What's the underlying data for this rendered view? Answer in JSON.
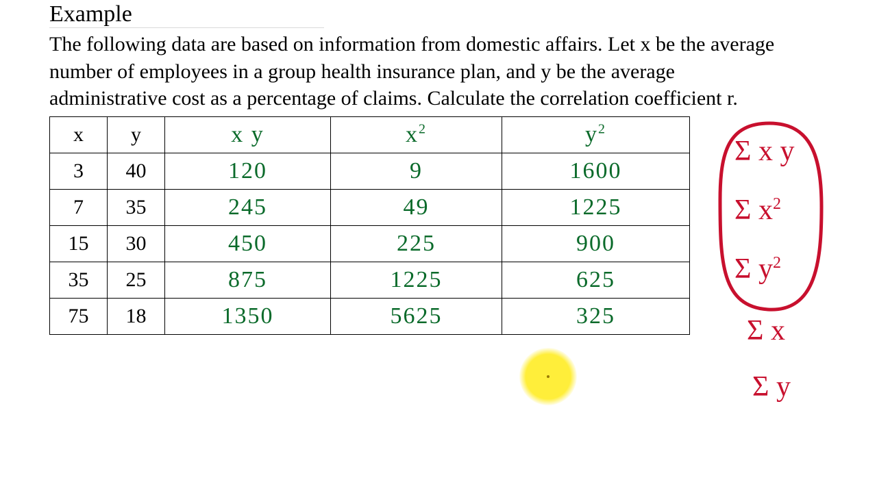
{
  "heading": "Example",
  "problem": "The following data are based on information from domestic affairs.  Let x be the average number of employees in a group health insurance plan, and y be the average administrative cost as a percentage of claims.  Calculate the correlation coefficient r.",
  "table": {
    "headers": {
      "x": "x",
      "y": "y",
      "xy": "x y",
      "x2_base": "x",
      "x2_sup": "2",
      "y2_base": "y",
      "y2_sup": "2"
    },
    "rows": [
      {
        "x": "3",
        "y": "40",
        "xy": "120",
        "x2": "9",
        "y2": "1600"
      },
      {
        "x": "7",
        "y": "35",
        "xy": "245",
        "x2": "49",
        "y2": "1225"
      },
      {
        "x": "15",
        "y": "30",
        "xy": "450",
        "x2": "225",
        "y2": "900"
      },
      {
        "x": "35",
        "y": "25",
        "xy": "875",
        "x2": "1225",
        "y2": "625"
      },
      {
        "x": "75",
        "y": "18",
        "xy": "1350",
        "x2": "5625",
        "y2": "325"
      }
    ]
  },
  "annotations": {
    "sum_xy": "Σ x y",
    "sum_x2_base": "Σ x",
    "sum_x2_sup": "2",
    "sum_y2_base": "Σ y",
    "sum_y2_sup": "2",
    "sum_x": "Σ x",
    "sum_y": "Σ y"
  }
}
